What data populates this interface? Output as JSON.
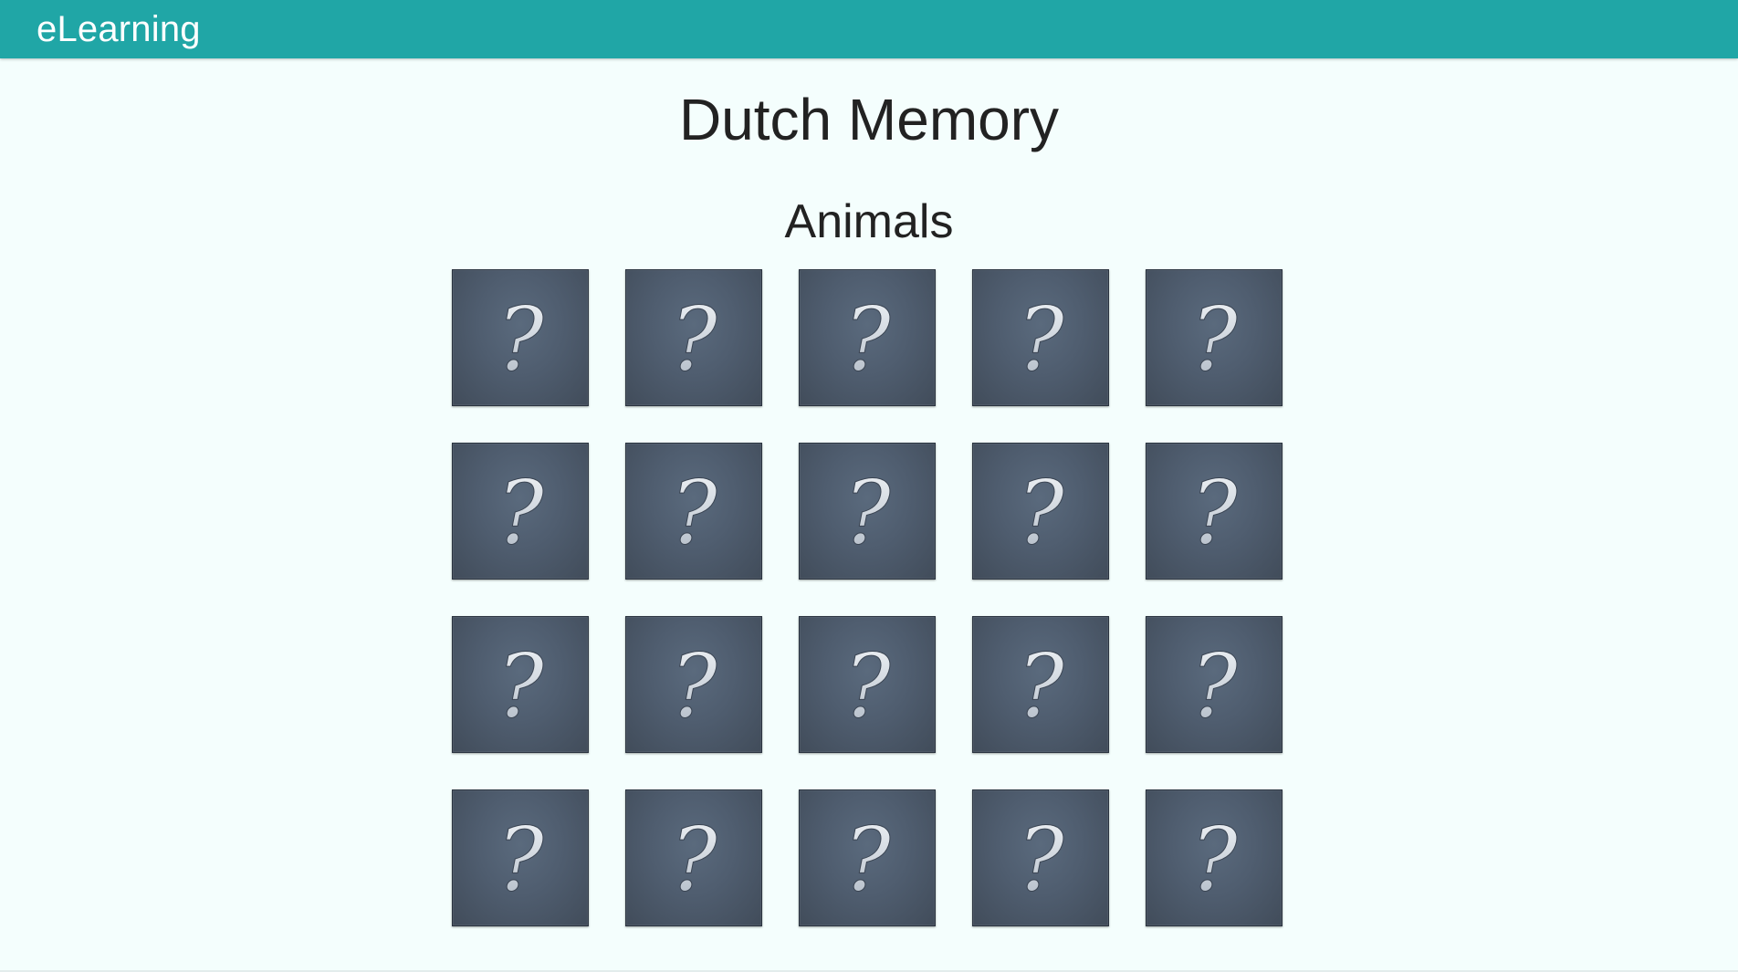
{
  "app": {
    "title": "eLearning",
    "brand_color": "#20a6a6"
  },
  "game": {
    "title": "Dutch Memory",
    "category": "Animals",
    "card_back_icon": "question-mark-icon",
    "cards": [
      {
        "face": "?"
      },
      {
        "face": "?"
      },
      {
        "face": "?"
      },
      {
        "face": "?"
      },
      {
        "face": "?"
      },
      {
        "face": "?"
      },
      {
        "face": "?"
      },
      {
        "face": "?"
      },
      {
        "face": "?"
      },
      {
        "face": "?"
      },
      {
        "face": "?"
      },
      {
        "face": "?"
      },
      {
        "face": "?"
      },
      {
        "face": "?"
      },
      {
        "face": "?"
      },
      {
        "face": "?"
      },
      {
        "face": "?"
      },
      {
        "face": "?"
      },
      {
        "face": "?"
      },
      {
        "face": "?"
      }
    ]
  }
}
